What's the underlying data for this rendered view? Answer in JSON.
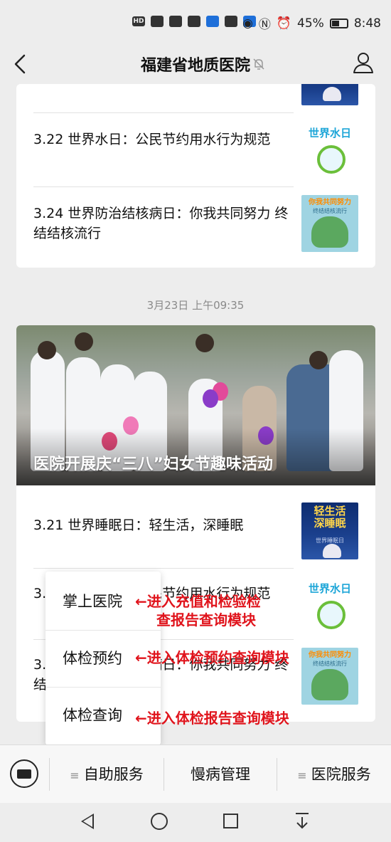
{
  "status": {
    "left_icons": [
      "hd-icon",
      "signal-icon",
      "app-icon",
      "qq-icon",
      "bird-icon",
      "chat-icon",
      "alipay-icon"
    ],
    "hd": "HD",
    "battery": "45%",
    "time": "8:48"
  },
  "navbar": {
    "title": "福建省地质医院"
  },
  "card1": {
    "items": [
      {
        "title": "3.22 世界水日：公民节约用水行为规范",
        "thumb": "world-water-day"
      },
      {
        "title": "3.24 世界防治结核病日：你我共同努力 终结结核流行",
        "thumb": "tb-day"
      }
    ]
  },
  "timestamp": "3月23日 上午09:35",
  "card2": {
    "cover_title": "医院开展庆“三八”妇女节趣味活动",
    "items": [
      {
        "title": "3.21 世界睡眠日：轻生活，深睡眠",
        "thumb": "sleep-day"
      },
      {
        "title": "3.22 世界水日：公民节约用水行为规范",
        "thumb": "world-water-day"
      },
      {
        "title": "3.24 世界防治结核病日：你我共同努力 终结结核流行",
        "thumb": "tb-day"
      }
    ]
  },
  "thumbs": {
    "sleep": {
      "line1": "轻生活",
      "line2": "深睡眠",
      "small": "世界睡眠日"
    },
    "water": {
      "text": "世界水日"
    },
    "tb": {
      "line1": "你我共同努力",
      "line2": "终结结核流行"
    }
  },
  "popup_menu": {
    "items": [
      "掌上医院",
      "体检预约",
      "体检查询"
    ]
  },
  "annotations": {
    "a1_line1": "←进入充值和检验检",
    "a1_line2": "查报告查询模块",
    "a2": "←进入体检预约查询模块",
    "a3": "←进入体检报告查询模块"
  },
  "menubar": {
    "items": [
      "自助服务",
      "慢病管理",
      "医院服务"
    ],
    "lines_glyph": "≡"
  },
  "colors": {
    "annotation": "#e0141c",
    "background": "#ededed"
  }
}
